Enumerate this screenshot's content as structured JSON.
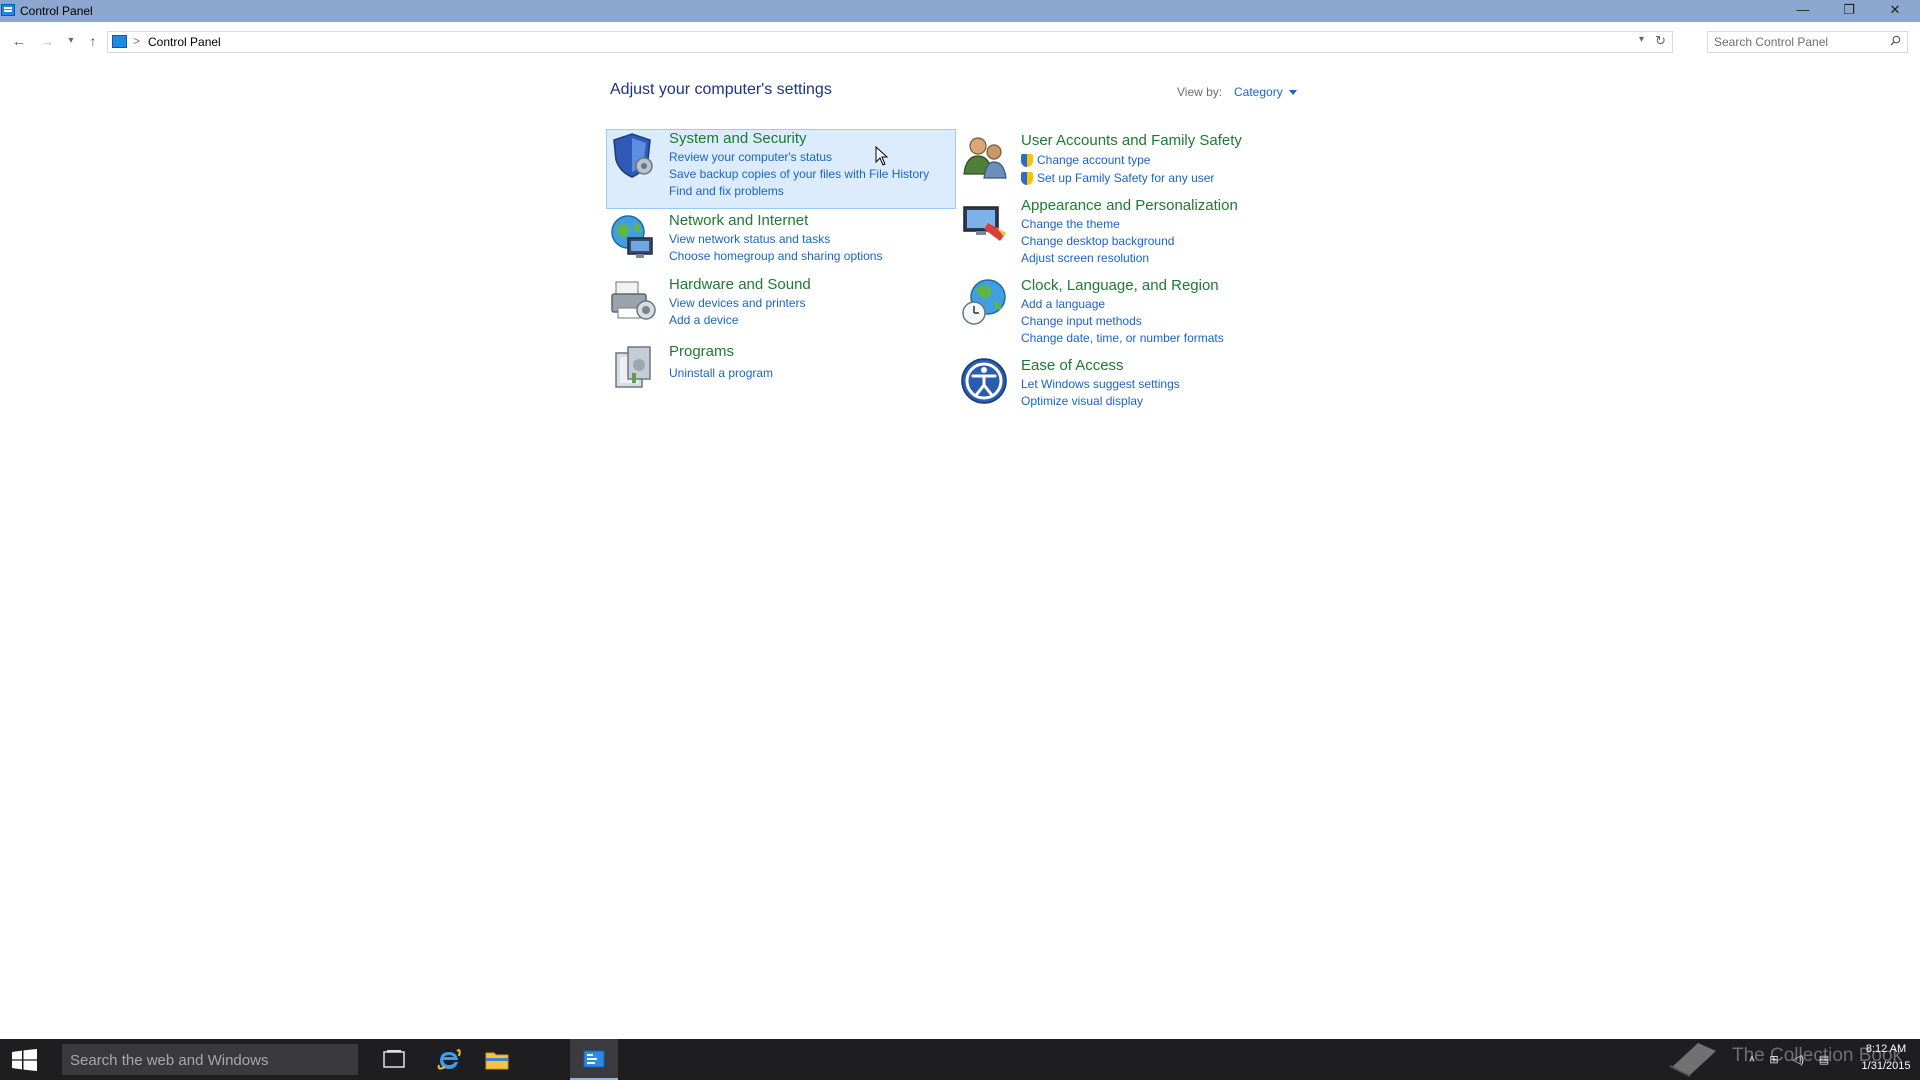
{
  "window": {
    "title": "Control Panel",
    "minimize_glyph": "—",
    "restore_glyph": "❐",
    "close_glyph": "✕"
  },
  "addressbar": {
    "breadcrumb": "Control Panel",
    "separator": ">",
    "search_placeholder": "Search Control Panel"
  },
  "content": {
    "heading": "Adjust your computer's settings",
    "view_by_label": "View by:",
    "view_by_value": "Category"
  },
  "categories": {
    "system": {
      "title": "System and Security",
      "links": [
        "Review your computer's status",
        "Save backup copies of your files with File History",
        "Find and fix problems"
      ]
    },
    "network": {
      "title": "Network and Internet",
      "links": [
        "View network status and tasks",
        "Choose homegroup and sharing options"
      ]
    },
    "hardware": {
      "title": "Hardware and Sound",
      "links": [
        "View devices and printers",
        "Add a device"
      ]
    },
    "programs": {
      "title": "Programs",
      "links": [
        "Uninstall a program"
      ]
    },
    "users": {
      "title": "User Accounts and Family Safety",
      "links": [
        "Change account type",
        "Set up Family Safety for any user"
      ]
    },
    "appearance": {
      "title": "Appearance and Personalization",
      "links": [
        "Change the theme",
        "Change desktop background",
        "Adjust screen resolution"
      ]
    },
    "clock": {
      "title": "Clock, Language, and Region",
      "links": [
        "Add a language",
        "Change input methods",
        "Change date, time, or number formats"
      ]
    },
    "ease": {
      "title": "Ease of Access",
      "links": [
        "Let Windows suggest settings",
        "Optimize visual display"
      ]
    }
  },
  "taskbar": {
    "search_placeholder": "Search the web and Windows",
    "watermark": "The Collection Book",
    "clock_time": "8:12 AM",
    "clock_date": "1/31/2015"
  },
  "colors": {
    "titlebar": "#8ba7cf",
    "heading": "#1e3287",
    "category_title": "#1e7a32",
    "link": "#1a64c8",
    "highlight": "#dcecfc",
    "taskbar": "#1e1e20"
  }
}
